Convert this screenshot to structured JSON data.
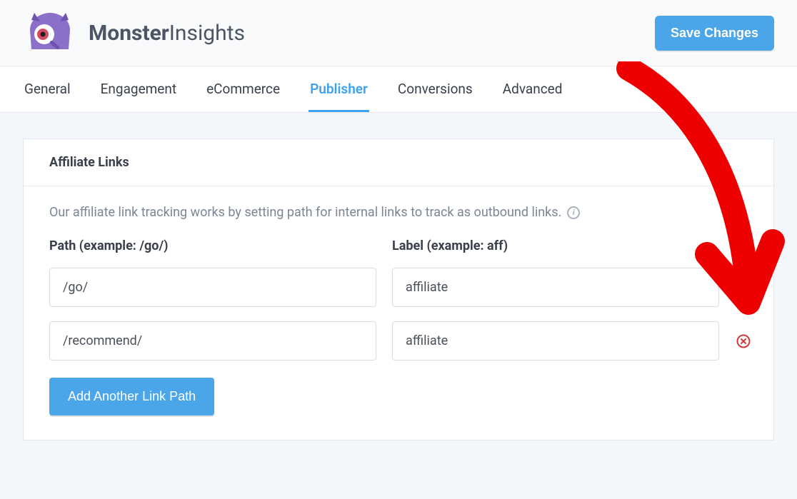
{
  "brand": {
    "name_bold": "Monster",
    "name_light": "Insights"
  },
  "buttons": {
    "save": "Save Changes",
    "add_link_path": "Add Another Link Path"
  },
  "tabs": [
    {
      "label": "General",
      "active": false
    },
    {
      "label": "Engagement",
      "active": false
    },
    {
      "label": "eCommerce",
      "active": false
    },
    {
      "label": "Publisher",
      "active": true
    },
    {
      "label": "Conversions",
      "active": false
    },
    {
      "label": "Advanced",
      "active": false
    }
  ],
  "panel": {
    "title": "Affiliate Links",
    "description": "Our affiliate link tracking works by setting path for internal links to track as outbound links.",
    "columns": {
      "path": "Path (example: /go/)",
      "label": "Label (example: aff)"
    },
    "rows": [
      {
        "path": "/go/",
        "label": "affiliate"
      },
      {
        "path": "/recommend/",
        "label": "affiliate"
      }
    ]
  },
  "colors": {
    "accent": "#4aa6e8",
    "danger": "#d63638"
  }
}
